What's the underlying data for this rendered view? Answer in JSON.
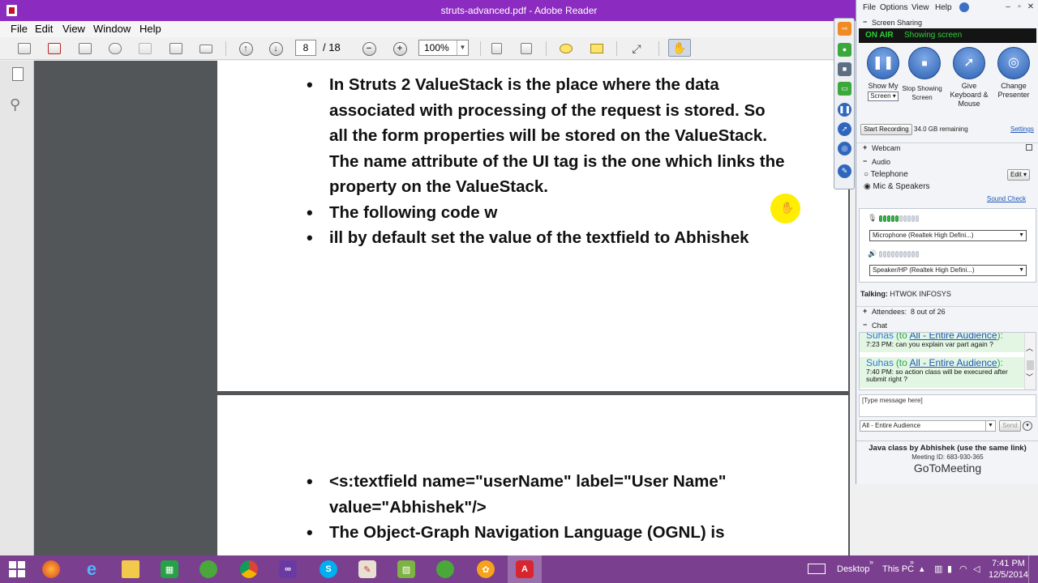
{
  "reader": {
    "window_title": "struts-advanced.pdf - Adobe Reader",
    "menu": [
      "File",
      "Edit",
      "View",
      "Window",
      "Help"
    ],
    "page_current": "8",
    "page_total": "/ 18",
    "zoom": "100%",
    "page1_bullets": [
      "In Struts 2 ValueStack is the place where the data associated with processing of the request is stored. So all the form properties will be stored on the ValueStack. The name attribute of the UI tag is the one which links the property on the ValueStack.",
      "The following code w",
      "ill by default set the value of the textfield to Abhishek"
    ],
    "page2_bullets": [
      "<s:textfield name=\"userName\" label=\"User Name\" value=\"Abhishek\"/>",
      "The Object-Graph Navigation Language (OGNL) is"
    ]
  },
  "gtm": {
    "menu": [
      "File",
      "Options",
      "View",
      "Help"
    ],
    "screen_sharing_label": "Screen Sharing",
    "on_air": "ON AIR",
    "showing_screen": "Showing screen",
    "buttons": {
      "show_my_label": "Show My",
      "screen_select": "Screen",
      "stop_label": "Stop Showing Screen",
      "give_label": "Give Keyboard & Mouse",
      "change_label": "Change Presenter"
    },
    "start_recording": "Start Recording",
    "storage_remaining": "34.0 GB remaining",
    "settings": "Settings",
    "webcam": "Webcam",
    "audio": "Audio",
    "telephone": "Telephone",
    "edit": "Edit",
    "mic_speakers": "Mic & Speakers",
    "sound_check": "Sound Check",
    "microphone_device": "Microphone (Realtek High Defini...)",
    "microphone_level": 0.5,
    "speaker_device": "Speaker/HP (Realtek High Defini...)",
    "speaker_level": 0,
    "talking_label": "Talking:",
    "talking_name": "HTWOK INFOSYS",
    "attendees_label": "Attendees:",
    "attendees_count": "8 out of 26",
    "chat": "Chat",
    "chat_messages": [
      {
        "sender": "Suhas",
        "to_prefix": "(to",
        "audience": "All - Entire Audience",
        "to_suffix": "):",
        "time_text": "7:23 PM: can you explain var part again ?"
      },
      {
        "sender": "Suhas",
        "to_prefix": "(to",
        "audience": "All - Entire Audience",
        "to_suffix": "):",
        "time_text": "7:40 PM: so action class will be execured after submit right ?"
      }
    ],
    "message_placeholder": "[Type message here]",
    "recipient": "All - Entire Audience",
    "send": "Send",
    "meeting_title": "Java class by Abhishek (use the same link)",
    "meeting_id": "Meeting ID: 683-930-365",
    "logo": "GoToMeeting"
  },
  "taskbar": {
    "desktop_label": "Desktop",
    "thispc_label": "This PC",
    "time": "7:41 PM",
    "date": "12/5/2014"
  },
  "colors": {
    "title_bar": "#8c2bbf",
    "taskbar": "#7a3f8f",
    "on_air_green": "#2fcf3a",
    "cursor_highlight": "#ffee00"
  }
}
